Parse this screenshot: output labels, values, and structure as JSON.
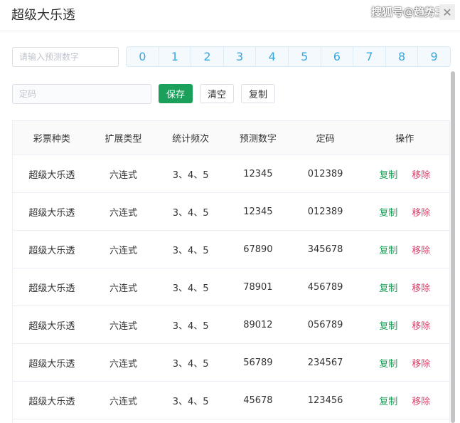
{
  "dialog": {
    "title": "超级大乐透",
    "watermark": "搜狐号@趋势王",
    "close_glyph": "✕"
  },
  "form": {
    "predict_placeholder": "请输入预测数字",
    "code_placeholder": "定码",
    "digits": [
      "0",
      "1",
      "2",
      "3",
      "4",
      "5",
      "6",
      "7",
      "8",
      "9"
    ],
    "save_label": "保存",
    "clear_label": "清空",
    "copy_label": "复制"
  },
  "table": {
    "headers": [
      "彩票种类",
      "扩展类型",
      "统计频次",
      "预测数字",
      "定码",
      "操作"
    ],
    "copy_action": "复制",
    "remove_action": "移除",
    "rows": [
      {
        "type": "超级大乐透",
        "ext": "六连式",
        "freq": "3、4、5",
        "predict": "12345",
        "code": "012389"
      },
      {
        "type": "超级大乐透",
        "ext": "六连式",
        "freq": "3、4、5",
        "predict": "12345",
        "code": "012389"
      },
      {
        "type": "超级大乐透",
        "ext": "六连式",
        "freq": "3、4、5",
        "predict": "67890",
        "code": "345678"
      },
      {
        "type": "超级大乐透",
        "ext": "六连式",
        "freq": "3、4、5",
        "predict": "78901",
        "code": "456789"
      },
      {
        "type": "超级大乐透",
        "ext": "六连式",
        "freq": "3、4、5",
        "predict": "89012",
        "code": "056789"
      },
      {
        "type": "超级大乐透",
        "ext": "六连式",
        "freq": "3、4、5",
        "predict": "56789",
        "code": "234567"
      },
      {
        "type": "超级大乐透",
        "ext": "六连式",
        "freq": "3、4、5",
        "predict": "45678",
        "code": "123456"
      }
    ]
  },
  "colors": {
    "primary": "#1aa05a",
    "danger": "#d8416a",
    "digit": "#3aa6de"
  }
}
